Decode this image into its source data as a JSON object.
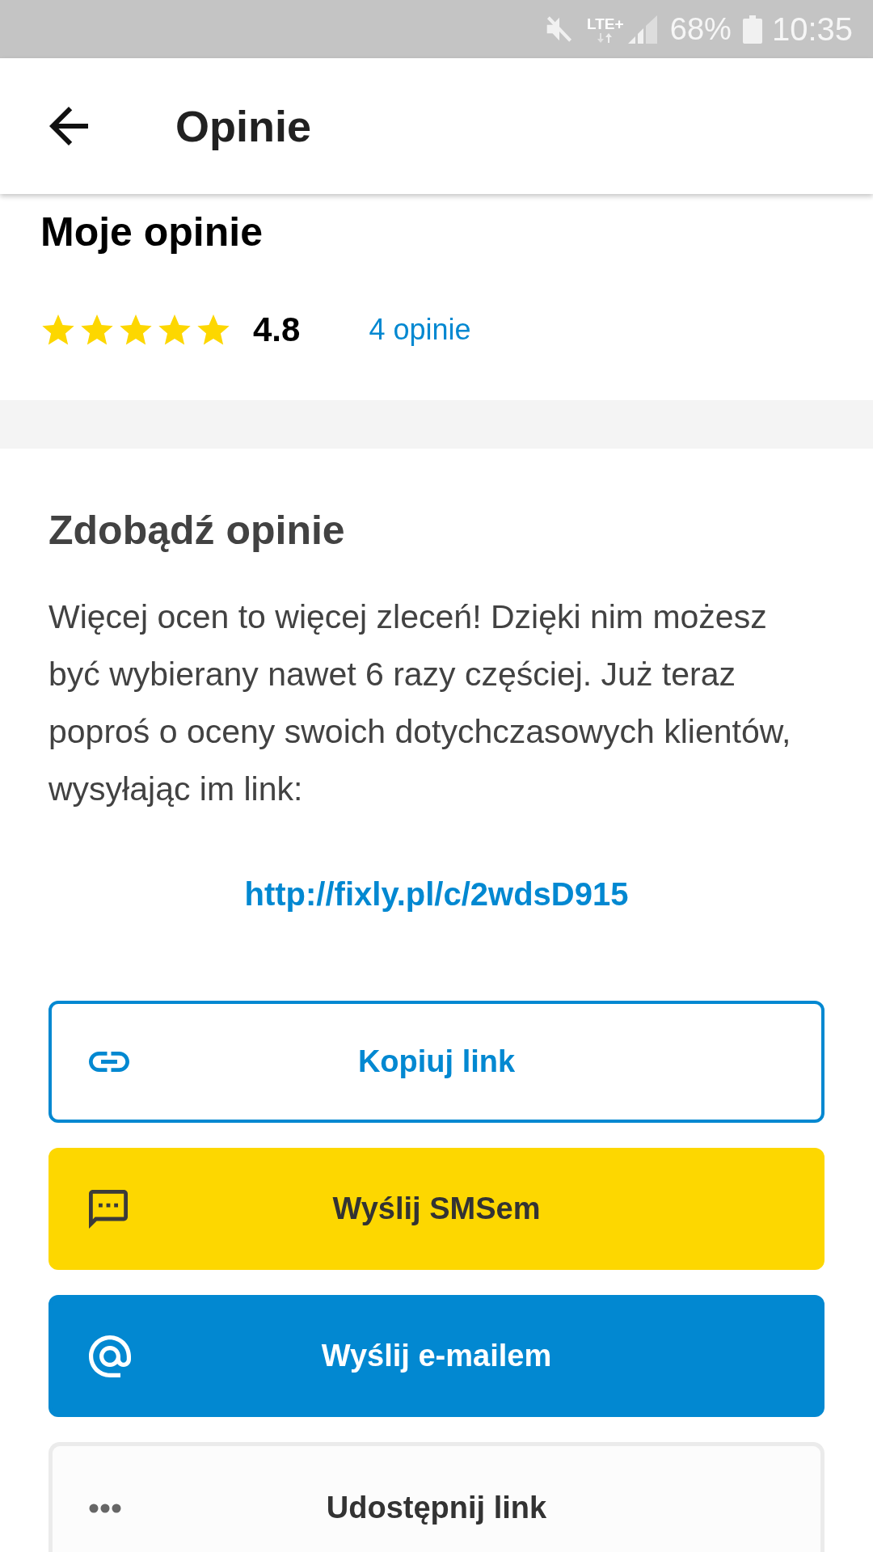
{
  "status_bar": {
    "network": "LTE+",
    "battery": "68%",
    "time": "10:35"
  },
  "app_bar": {
    "title": "Opinie"
  },
  "my_reviews": {
    "title": "Moje opinie",
    "stars": 5,
    "rating": "4.8",
    "count_link": "4 opinie"
  },
  "get_reviews": {
    "title": "Zdobądź opinie",
    "text": "Więcej ocen to więcej zleceń! Dzięki nim możesz być wybierany nawet 6 razy częściej. Już teraz poproś o oceny swoich dotychczasowych klientów, wysyłając im link:",
    "link": "http://fixly.pl/c/2wdsD915"
  },
  "actions": [
    {
      "kind": "copy",
      "label": "Kopiuj link"
    },
    {
      "kind": "sms",
      "label": "Wyślij SMSem"
    },
    {
      "kind": "email",
      "label": "Wyślij e-mailem"
    },
    {
      "kind": "share",
      "label": "Udostępnij link"
    }
  ]
}
